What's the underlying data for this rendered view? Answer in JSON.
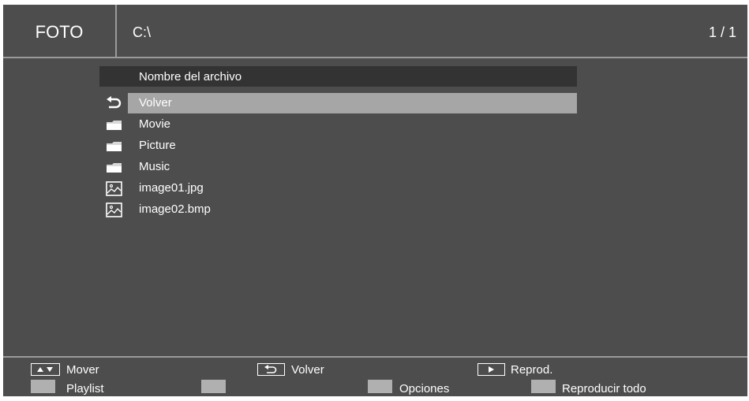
{
  "header": {
    "app_title": "FOTO",
    "path": "C:\\",
    "page_counter": "1 / 1"
  },
  "file_list": {
    "column_header": "Nombre del archivo",
    "items": [
      {
        "label": "Volver",
        "icon": "return-icon",
        "selected": true
      },
      {
        "label": "Movie",
        "icon": "folder-icon"
      },
      {
        "label": "Picture",
        "icon": "folder-icon"
      },
      {
        "label": "Music",
        "icon": "folder-icon"
      },
      {
        "label": "image01.jpg",
        "icon": "image-file-icon"
      },
      {
        "label": "image02.bmp",
        "icon": "image-file-icon"
      }
    ]
  },
  "footer": {
    "move_label": "Mover",
    "back_label": "Volver",
    "play_label": "Reprod.",
    "playlist_label": "Playlist",
    "options_label": "Opciones",
    "play_all_label": "Reproducir todo"
  },
  "colors": {
    "background": "#4d4d4d",
    "header_bar": "#333333",
    "selection": "#a6a6a6",
    "divider": "#9a9a9a",
    "text": "#ffffff"
  }
}
